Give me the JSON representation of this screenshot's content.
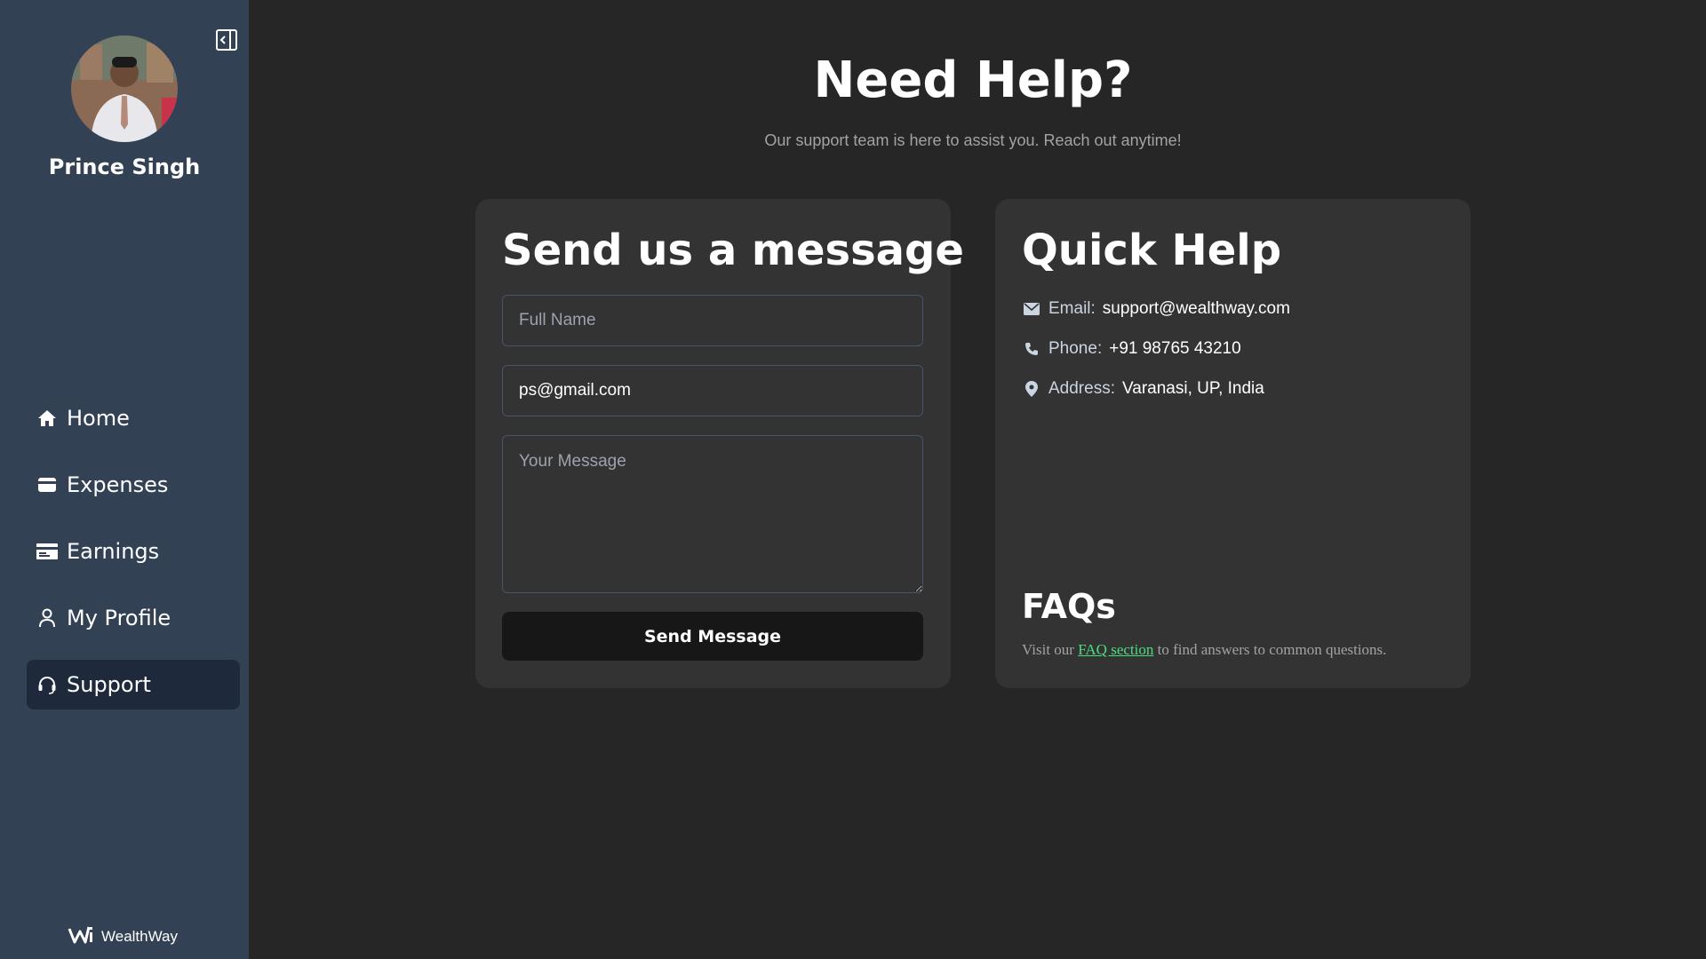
{
  "sidebar": {
    "user_name": "Prince Singh",
    "items": [
      {
        "label": "Home",
        "icon": "home-icon"
      },
      {
        "label": "Expenses",
        "icon": "wallet-icon"
      },
      {
        "label": "Earnings",
        "icon": "credit-card-icon"
      },
      {
        "label": "My Profile",
        "icon": "user-icon"
      },
      {
        "label": "Support",
        "icon": "headset-icon"
      }
    ],
    "active_item": "Support",
    "brand": "WealthWay"
  },
  "header": {
    "title": "Need Help?",
    "subtitle": "Our support team is here to assist you. Reach out anytime!"
  },
  "message_form": {
    "title": "Send us a message",
    "name_placeholder": "Full Name",
    "email_value": "ps@gmail.com",
    "message_placeholder": "Your Message",
    "submit_label": "Send Message"
  },
  "quick_help": {
    "title": "Quick Help",
    "email_label": "Email:",
    "email_value": "support@wealthway.com",
    "phone_label": "Phone:",
    "phone_value": "+91 98765 43210",
    "address_label": "Address:",
    "address_value": "Varanasi, UP, India",
    "faq_title": "FAQs",
    "faq_prefix": "Visit our ",
    "faq_link": "FAQ section",
    "faq_suffix": " to find answers to common questions."
  },
  "colors": {
    "background": "#262626",
    "sidebar": "#334155",
    "card": "#333333",
    "active_nav": "#1e293b",
    "link": "#4ade80",
    "button": "#171717"
  }
}
